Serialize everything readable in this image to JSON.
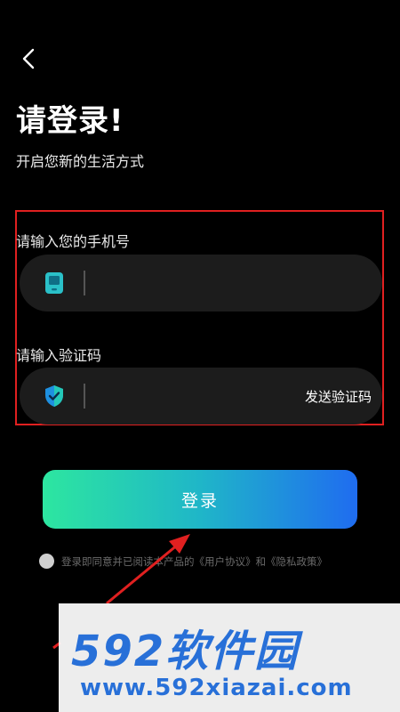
{
  "header": {
    "back_icon": "chevron-left-icon",
    "title": "请登录!",
    "subtitle": "开启您新的生活方式"
  },
  "phone": {
    "label": "请输入您的手机号",
    "icon": "phone-icon",
    "value": "",
    "placeholder": ""
  },
  "code": {
    "label": "请输入验证码",
    "icon": "shield-check-icon",
    "value": "",
    "placeholder": "",
    "send_label": "发送验证码"
  },
  "login": {
    "label": "登录"
  },
  "agreement": {
    "prefix": "登录即同意并已阅读本产品的",
    "user_agreement": "《用户协议》",
    "and": "和",
    "privacy_policy": "《隐私政策》"
  },
  "watermark": {
    "logo": "592软件园",
    "url": "www.592xiazai.com"
  },
  "colors": {
    "highlight": "#e02020",
    "gradient_start": "#2de6a0",
    "gradient_end": "#1f6cf0",
    "watermark": "#2870d8"
  }
}
